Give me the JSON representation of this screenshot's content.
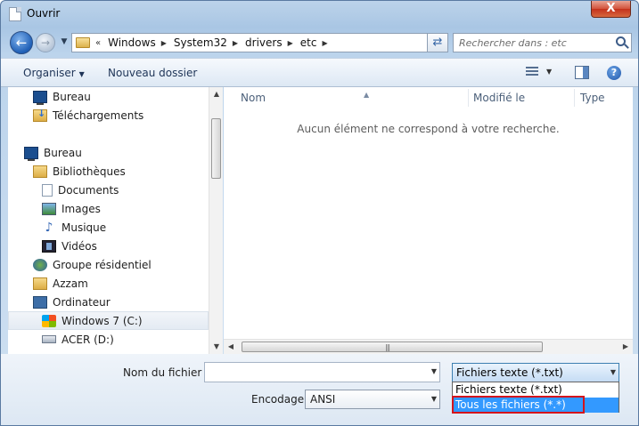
{
  "window": {
    "title": "Ouvrir",
    "close_label": "X"
  },
  "nav": {
    "breadcrumb_prefix": "«",
    "breadcrumbs": [
      "Windows",
      "System32",
      "drivers",
      "etc"
    ],
    "search_placeholder": "Rechercher dans : etc"
  },
  "toolbar": {
    "organise_label": "Organiser",
    "new_folder_label": "Nouveau dossier",
    "help_label": "?"
  },
  "sidebar": {
    "items": [
      {
        "label": "Bureau",
        "icon": "desktop-icon"
      },
      {
        "label": "Téléchargements",
        "icon": "downloads-icon"
      },
      {
        "label": "Bureau",
        "icon": "desktop-icon"
      },
      {
        "label": "Bibliothèques",
        "icon": "libraries-icon"
      },
      {
        "label": "Documents",
        "icon": "documents-icon"
      },
      {
        "label": "Images",
        "icon": "pictures-icon"
      },
      {
        "label": "Musique",
        "icon": "music-icon"
      },
      {
        "label": "Vidéos",
        "icon": "videos-icon"
      },
      {
        "label": "Groupe résidentiel",
        "icon": "homegroup-icon"
      },
      {
        "label": "Azzam",
        "icon": "user-folder-icon"
      },
      {
        "label": "Ordinateur",
        "icon": "computer-icon"
      },
      {
        "label": "Windows 7 (C:)",
        "icon": "windows-drive-icon"
      },
      {
        "label": "ACER (D:)",
        "icon": "drive-icon"
      }
    ]
  },
  "file_list": {
    "columns": [
      "Nom",
      "Modifié le",
      "Type"
    ],
    "empty_message": "Aucun élément ne correspond à votre recherche."
  },
  "form": {
    "filename_label": "Nom du fichier :",
    "filename_value": "",
    "encoding_label": "Encodage :",
    "encoding_value": "ANSI",
    "filetype_value": "Fichiers texte (*.txt)",
    "filetype_options": [
      "Fichiers texte (*.txt)",
      "Tous les fichiers  (*.*)"
    ]
  },
  "colors": {
    "selection": "#3399ff",
    "highlight_border": "#d4141c",
    "window_frame": "#a9c6e4"
  }
}
